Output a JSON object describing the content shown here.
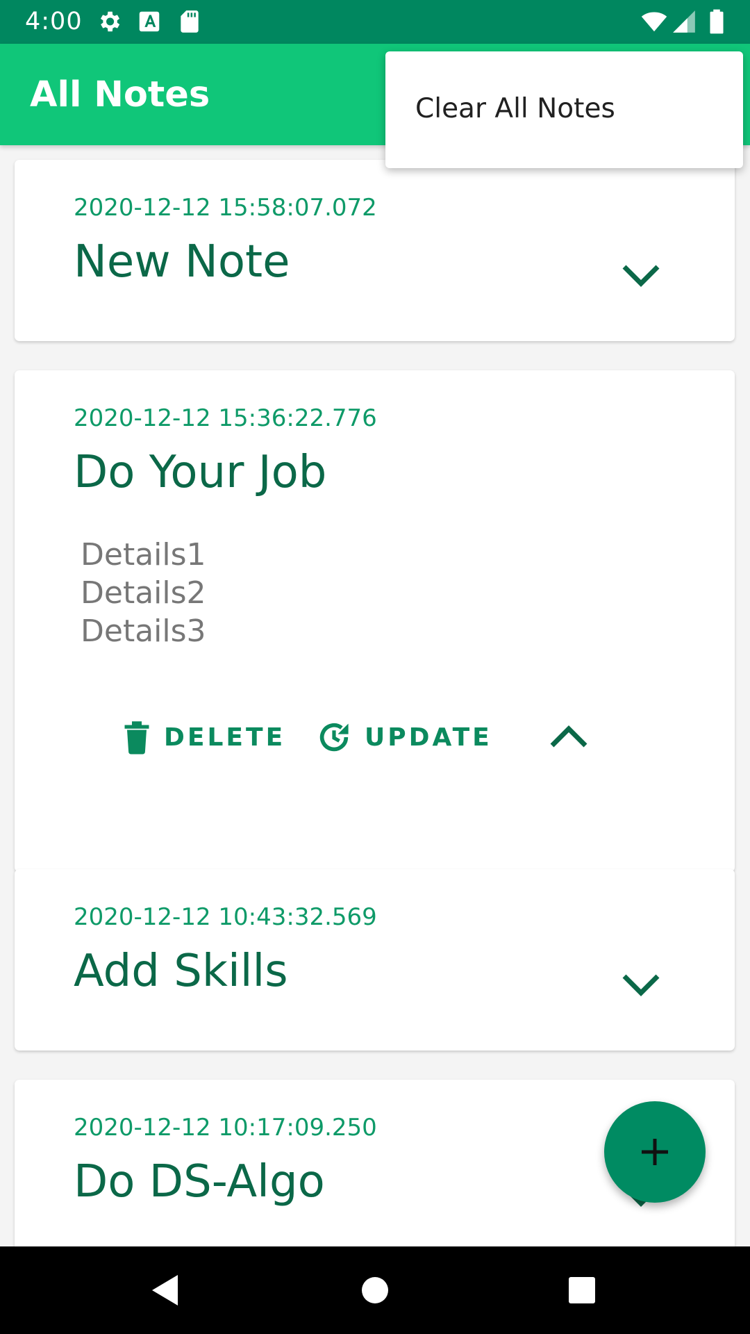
{
  "status_bar": {
    "time": "4:00"
  },
  "app_bar": {
    "title": "All Notes"
  },
  "overflow_menu": {
    "items": [
      {
        "label": "Clear All Notes"
      }
    ]
  },
  "notes": [
    {
      "date": "2020-12-12 15:58:07.072",
      "title": "New Note",
      "expanded": false
    },
    {
      "date": "2020-12-12 15:36:22.776",
      "title": "Do Your Job",
      "expanded": true,
      "details": [
        "Details1",
        "Details2",
        "Details3"
      ],
      "actions": {
        "delete_label": "DELETE",
        "update_label": "UPDATE"
      }
    },
    {
      "date": "2020-12-12 10:43:32.569",
      "title": "Add Skills",
      "expanded": false
    },
    {
      "date": "2020-12-12 10:17:09.250",
      "title": "Do DS-Algo",
      "expanded": false
    }
  ],
  "colors": {
    "status_bar": "#00875f",
    "app_bar": "#10c679",
    "accent": "#008b62",
    "title_text": "#0b6848",
    "date_text": "#0e9a68"
  },
  "icons": {
    "status": [
      "gear-icon",
      "text-a-icon",
      "sd-card-icon",
      "wifi-icon",
      "signal-icon",
      "battery-icon"
    ],
    "card": [
      "chevron-down-icon",
      "chevron-up-icon",
      "trash-icon",
      "update-icon"
    ],
    "fab": "plus-icon",
    "nav": [
      "back-icon",
      "home-icon",
      "recents-icon"
    ]
  }
}
